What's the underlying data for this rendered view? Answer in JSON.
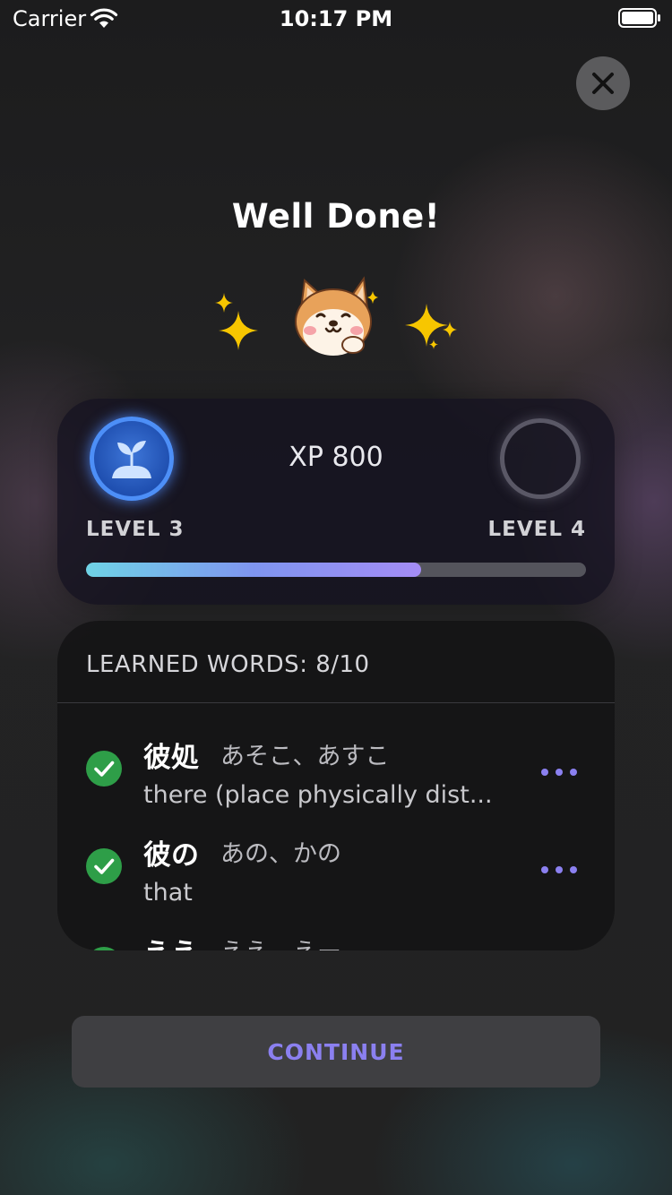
{
  "status_bar": {
    "carrier": "Carrier",
    "time": "10:17 PM"
  },
  "title": "Well Done!",
  "icons": [
    "sparkles-icon",
    "shiba-dog-icon",
    "seedling-icon",
    "checkmark-icon",
    "more-dots-icon",
    "close-icon"
  ],
  "level": {
    "xp": "XP 800",
    "current_label": "LEVEL 3",
    "next_label": "LEVEL 4",
    "progress": 0.67
  },
  "words": {
    "header": "LEARNED WORDS: 8/10",
    "items": [
      {
        "kanji": "彼処",
        "reading": "あそこ、あすこ",
        "meaning": "there (place physically dist..."
      },
      {
        "kanji": "彼の",
        "reading": "あの、かの",
        "meaning": "that"
      },
      {
        "kanji": "ええ",
        "reading": "ええ、えー",
        "meaning": ""
      }
    ]
  },
  "continue_label": "CONTINUE",
  "colors": {
    "accent": "#8b80f0",
    "check": "#2e9e48",
    "badge": "#4d8ff7"
  }
}
